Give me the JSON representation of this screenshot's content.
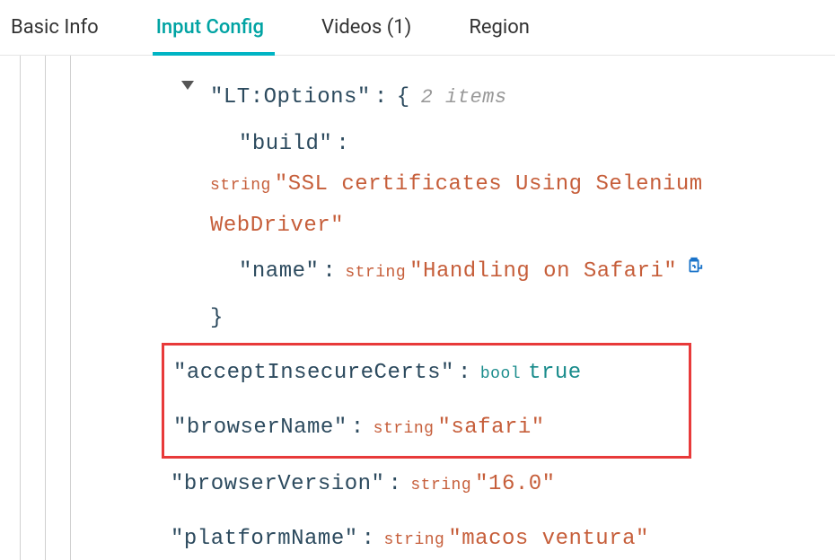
{
  "tabs": [
    {
      "label": "Basic Info",
      "active": false
    },
    {
      "label": "Input Config",
      "active": true
    },
    {
      "label": "Videos (1)",
      "active": false
    },
    {
      "label": "Region",
      "active": false
    }
  ],
  "json": {
    "ltOptions": {
      "key": "\"LT:Options\"",
      "brace_open": "{",
      "meta": "2 items",
      "build": {
        "key": "\"build\"",
        "type": "string",
        "value": "\"SSL certificates Using Selenium WebDriver\"",
        "value_line1": "\"SSL certificates Using Selenium",
        "value_line2": "WebDriver\""
      },
      "name": {
        "key": "\"name\"",
        "type": "string",
        "value": "\"Handling on Safari\""
      },
      "brace_close": "}"
    },
    "acceptInsecureCerts": {
      "key": "\"acceptInsecureCerts\"",
      "type": "bool",
      "value": "true"
    },
    "browserName": {
      "key": "\"browserName\"",
      "type": "string",
      "value": "\"safari\""
    },
    "browserVersion": {
      "key": "\"browserVersion\"",
      "type": "string",
      "value": "\"16.0\""
    },
    "platformName": {
      "key": "\"platformName\"",
      "type": "string",
      "value": "\"macos ventura\""
    }
  },
  "icons": {
    "copy": "clipboard"
  }
}
